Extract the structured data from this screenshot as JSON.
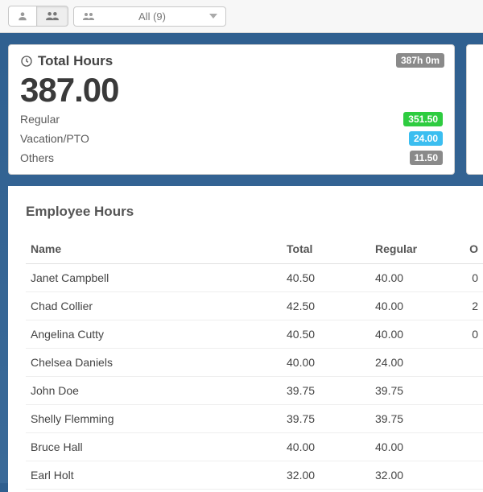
{
  "toolbar": {
    "dropdown_label": "All (9)"
  },
  "total_hours": {
    "title": "Total Hours",
    "badge": "387h 0m",
    "grand": "387.00",
    "rows": [
      {
        "label": "Regular",
        "value": "351.50",
        "color": "green"
      },
      {
        "label": "Vacation/PTO",
        "value": "24.00",
        "color": "blue"
      },
      {
        "label": "Others",
        "value": "11.50",
        "color": "gray"
      }
    ]
  },
  "employee_hours": {
    "title": "Employee Hours",
    "columns": {
      "name": "Name",
      "total": "Total",
      "regular": "Regular",
      "ot": "O"
    },
    "rows": [
      {
        "name": "Janet Campbell",
        "total": "40.50",
        "regular": "40.00",
        "ot": "0"
      },
      {
        "name": "Chad Collier",
        "total": "42.50",
        "regular": "40.00",
        "ot": "2"
      },
      {
        "name": "Angelina Cutty",
        "total": "40.50",
        "regular": "40.00",
        "ot": "0"
      },
      {
        "name": "Chelsea Daniels",
        "total": "40.00",
        "regular": "24.00",
        "ot": ""
      },
      {
        "name": "John Doe",
        "total": "39.75",
        "regular": "39.75",
        "ot": ""
      },
      {
        "name": "Shelly Flemming",
        "total": "39.75",
        "regular": "39.75",
        "ot": ""
      },
      {
        "name": "Bruce Hall",
        "total": "40.00",
        "regular": "40.00",
        "ot": ""
      },
      {
        "name": "Earl Holt",
        "total": "32.00",
        "regular": "32.00",
        "ot": ""
      }
    ]
  }
}
